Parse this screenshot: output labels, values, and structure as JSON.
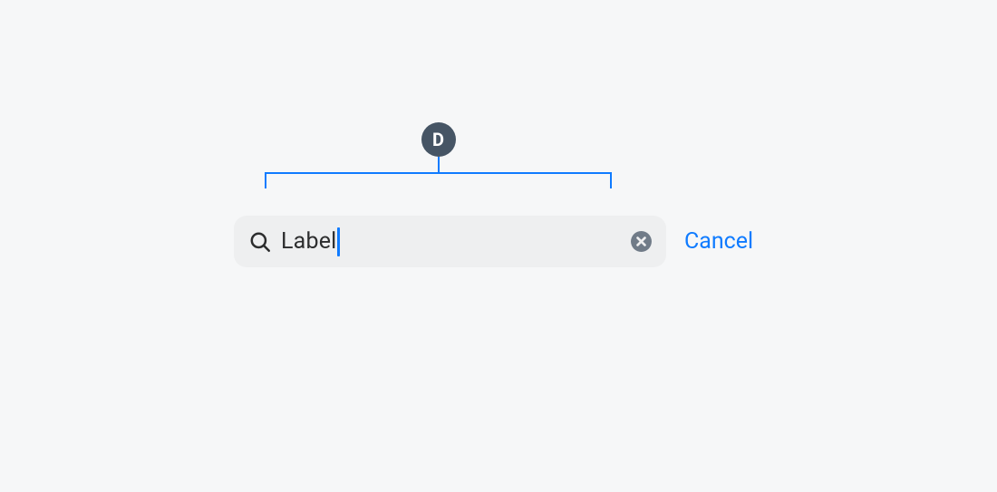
{
  "callout": {
    "label": "D"
  },
  "search": {
    "value": "Label",
    "placeholder": "",
    "cancel_label": "Cancel"
  },
  "colors": {
    "accent": "#0f7bff",
    "badge_bg": "#465565",
    "field_bg": "#eeeff0",
    "page_bg": "#f6f7f8",
    "text": "#2c2d2e",
    "icon_muted": "#707b88"
  }
}
